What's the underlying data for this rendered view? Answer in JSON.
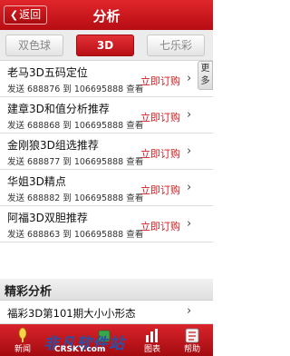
{
  "header": {
    "back_label": "返回",
    "title": "分析"
  },
  "tabs": [
    {
      "label": "双色球",
      "active": false
    },
    {
      "label": "3D",
      "active": true
    },
    {
      "label": "七乐彩",
      "active": false
    }
  ],
  "more_label": "更多",
  "items": [
    {
      "title": "老马3D五码定位",
      "sub": "发送 688876 到 106695888 查看",
      "action": "立即订购"
    },
    {
      "title": "建章3D和值分析推荐",
      "sub": "发送 688868 到 106695888 查看",
      "action": "立即订购"
    },
    {
      "title": "金刚狼3D组选推荐",
      "sub": "发送 688877 到 106695888 查看",
      "action": "立即订购"
    },
    {
      "title": "华姐3D精点",
      "sub": "发送 688882 到 106695888 查看",
      "action": "立即订购"
    },
    {
      "title": "阿福3D双胆推荐",
      "sub": "发送 688863 到 106695888 查看",
      "action": "立即订购"
    }
  ],
  "section": {
    "title": "精彩分析"
  },
  "articles": [
    {
      "title": "福彩3D第101期大小小形态"
    }
  ],
  "bottom_nav": [
    {
      "label": "新闻",
      "icon": "microphone-icon"
    },
    {
      "label": "",
      "icon": "lottery-icon"
    },
    {
      "label": "图表",
      "icon": "chart-icon"
    },
    {
      "label": "帮助",
      "icon": "help-icon"
    }
  ],
  "watermark": {
    "text": "非凡软件站",
    "sub": "CRSKY.com"
  },
  "colors": {
    "brand_red": "#c8161c",
    "link_red": "#d01a1f"
  }
}
